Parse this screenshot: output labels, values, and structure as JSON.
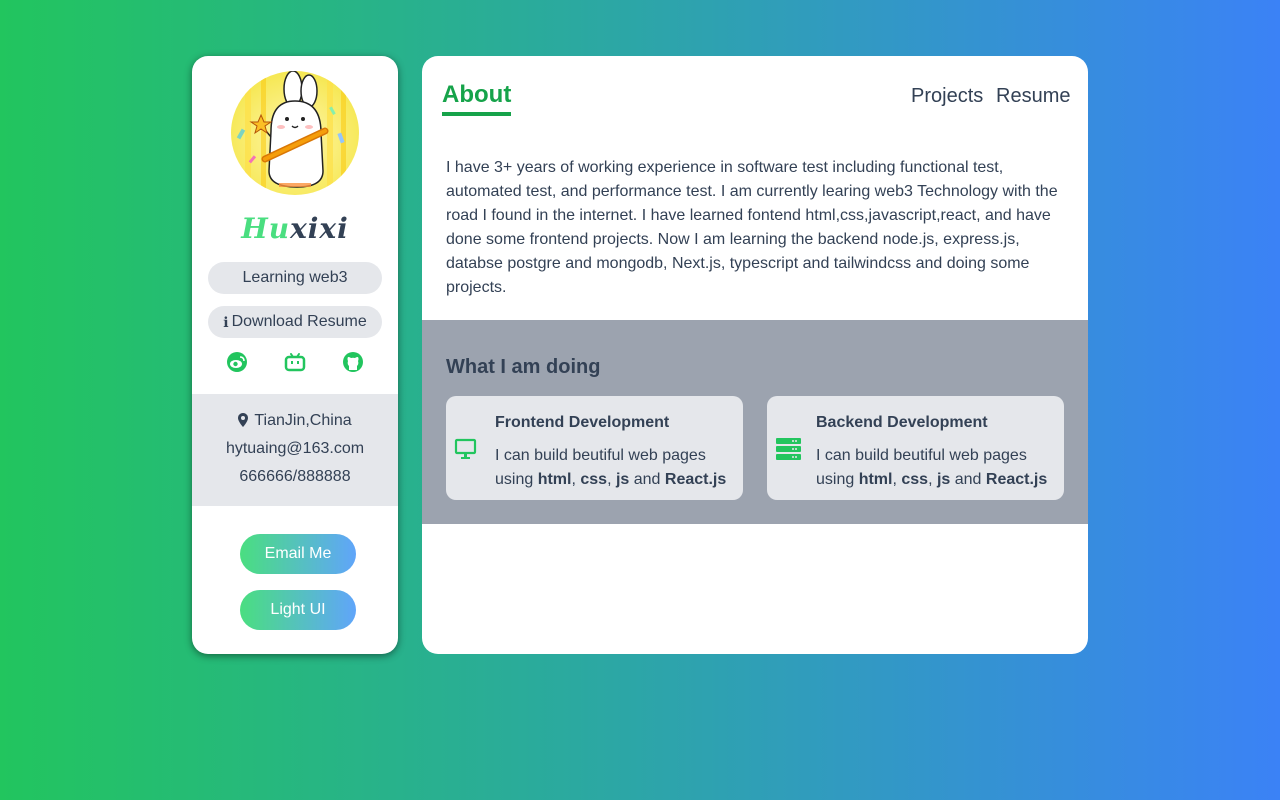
{
  "profile": {
    "name_part1": "Hu",
    "name_part2": "xixi",
    "status": "Learning web3",
    "download_label": "Download Resume",
    "download_icon": "ℹ",
    "socials": [
      "weibo-icon",
      "bilibili-icon",
      "github-icon"
    ],
    "location": "TianJin,China",
    "email": "hytuaing@163.com",
    "phone": "666666/888888",
    "email_button": "Email Me",
    "theme_button": "Light UI"
  },
  "nav": {
    "active": "About",
    "projects": "Projects",
    "resume": "Resume"
  },
  "about": {
    "text": "I have 3+ years of working experience in software test including functional test, automated test, and performance test. I am currently learing web3 Technology with the road I found in the internet. I have learned fontend html,css,javascript,react, and have done some frontend projects. Now I am learning the backend node.js, express.js, databse postgre and mongodb, Next.js, typescript and tailwindcss and doing some projects."
  },
  "doing": {
    "title": "What I am doing",
    "cards": [
      {
        "title": "Frontend Development",
        "desc_prefix": "I can build beutiful web pages using ",
        "t1": "html",
        "sep1": ", ",
        "t2": "css",
        "sep2": ", ",
        "t3": "js",
        "sep3": " and ",
        "t4": "React.js",
        "icon": "monitor-icon"
      },
      {
        "title": "Backend Development",
        "desc_prefix": "I can build beutiful web pages using ",
        "t1": "html",
        "sep1": ", ",
        "t2": "css",
        "sep2": ", ",
        "t3": "js",
        "sep3": " and ",
        "t4": "React.js",
        "icon": "server-icon"
      }
    ]
  },
  "colors": {
    "accent": "#16a34a",
    "icon_green": "#22c55e",
    "text": "#334155",
    "pill_bg": "#e5e7eb",
    "section_bg": "#9ca3af"
  }
}
